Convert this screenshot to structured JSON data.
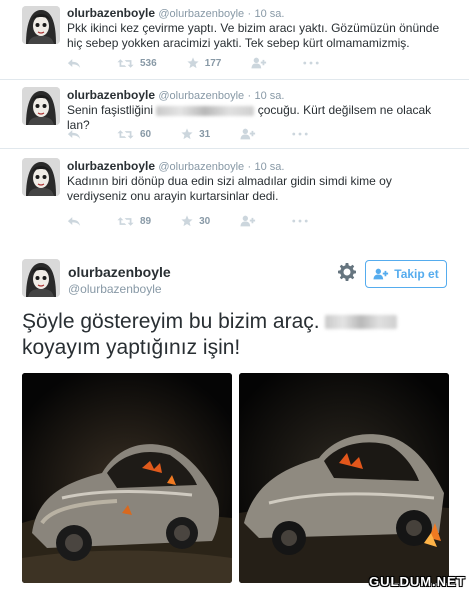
{
  "tweets": [
    {
      "name": "olurbazenboyle",
      "handle": "@olurbazenboyle",
      "sep": "·",
      "time": "10 sa.",
      "text": "Pkk ikinci kez çevirme yaptı. Ve bizim aracı yaktı. Gözümüzün önünde hiç sebep yokken aracimizi yakti. Tek sebep kürt olmamamizmiş.",
      "retweets": "536",
      "favorites": "177"
    },
    {
      "name": "olurbazenboyle",
      "handle": "@olurbazenboyle",
      "sep": "·",
      "time": "10 sa.",
      "text_before": "Senin faşistliğini",
      "text_after": "çocuğu. Kürt değilsem ne olacak lan?",
      "retweets": "60",
      "favorites": "31"
    },
    {
      "name": "olurbazenboyle",
      "handle": "@olurbazenboyle",
      "sep": "·",
      "time": "10 sa.",
      "text": "Kadının biri dönüp dua edin sizi almadılar gidin simdi kime oy verdiyseniz onu arayin kurtarsinlar dedi.",
      "retweets": "89",
      "favorites": "30"
    }
  ],
  "main_tweet": {
    "name": "olurbazenboyle",
    "handle": "@olurbazenboyle",
    "follow_label": "Takip et",
    "text_line1": "Şöyle göstereyim bu bizim araç.",
    "text_line2": "koyayım yaptığınız işin!"
  },
  "watermark": "GULDUM.NET",
  "icons": [
    "reply-icon",
    "retweet-icon",
    "favorite-icon",
    "follow-icon",
    "more-icon",
    "gear-icon",
    "add-user-icon"
  ],
  "colors": {
    "link": "#55acee",
    "muted": "#8899a6",
    "text": "#292f33",
    "border": "#e1e8ed"
  }
}
